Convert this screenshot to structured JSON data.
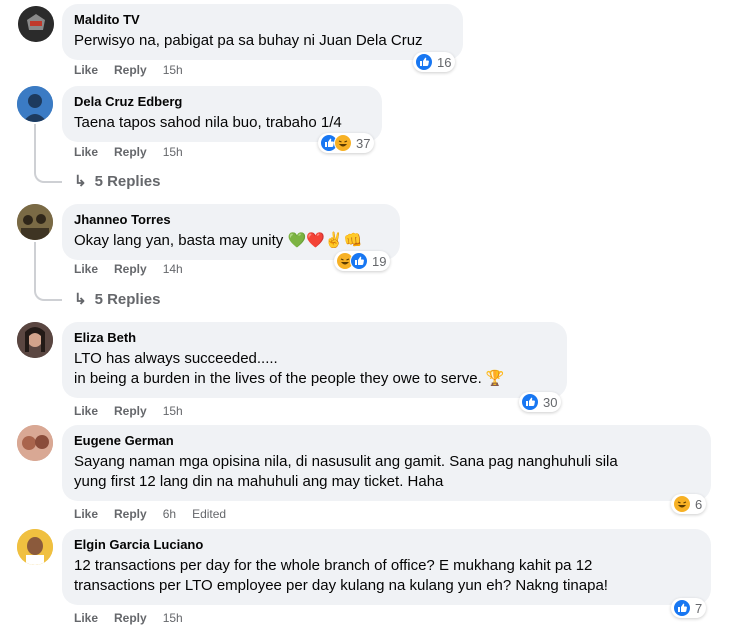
{
  "comments": [
    {
      "author": "Maldito TV",
      "text": "Perwisyo na, pabigat pa sa buhay ni Juan Dela Cruz",
      "like": "Like",
      "reply": "Reply",
      "time": "15h",
      "reactions": [
        "like"
      ],
      "reaction_count": "16"
    },
    {
      "author": "Dela Cruz Edberg",
      "text": "Taena tapos sahod nila buo, trabaho 1/4",
      "like": "Like",
      "reply": "Reply",
      "time": "15h",
      "reactions": [
        "like",
        "haha"
      ],
      "reaction_count": "37",
      "replies": "5 Replies"
    },
    {
      "author": "Jhanneo Torres",
      "text": "Okay lang yan, basta may unity 💚❤️✌️👊",
      "like": "Like",
      "reply": "Reply",
      "time": "14h",
      "reactions": [
        "haha",
        "like"
      ],
      "reaction_count": "19",
      "replies": "5 Replies"
    },
    {
      "author": "Eliza Beth",
      "text": "LTO has always succeeded.....\nin being a burden in the lives of the people they owe to serve. 🏆",
      "like": "Like",
      "reply": "Reply",
      "time": "15h",
      "reactions": [
        "like"
      ],
      "reaction_count": "30"
    },
    {
      "author": "Eugene German",
      "text": "Sayang naman mga opisina nila, di nasusulit ang gamit. Sana pag nanghuhuli sila\nyung first 12 lang din na mahuhuli ang may ticket. Haha",
      "like": "Like",
      "reply": "Reply",
      "time": "6h",
      "edited": "Edited",
      "reactions": [
        "haha"
      ],
      "reaction_count": "6"
    },
    {
      "author": "Elgin Garcia Luciano",
      "text": "12 transactions per day for the whole branch of office? E mukhang kahit pa 12\ntransactions per LTO employee per day kulang na kulang yun eh? Nakng tinapa!",
      "like": "Like",
      "reply": "Reply",
      "time": "15h",
      "reactions": [
        "like"
      ],
      "reaction_count": "7"
    }
  ],
  "colors": {
    "bubble": "#f0f2f5",
    "like_blue": "#1877f2",
    "haha_yellow": "#f7b125",
    "meta_gray": "#65676b",
    "text": "#050505"
  },
  "icons": {
    "reply_arrow": "↳"
  }
}
